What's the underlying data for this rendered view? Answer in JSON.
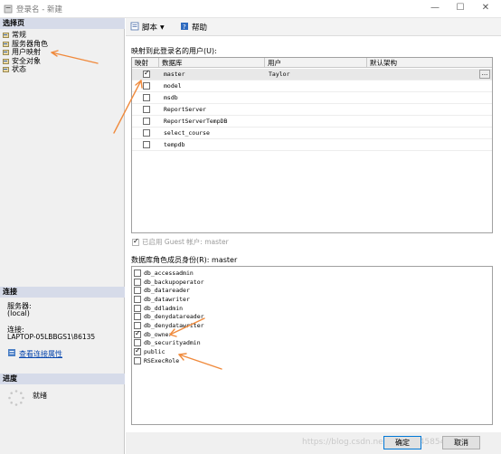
{
  "window": {
    "title": "登录名 - 新建"
  },
  "left": {
    "select_page_header": "选择页",
    "nav_items": [
      "常规",
      "服务器角色",
      "用户映射",
      "安全对象",
      "状态"
    ],
    "connection_header": "连接",
    "server_label": "服务器:",
    "server_value": "(local)",
    "connection_label": "连接:",
    "connection_value": "LAPTOP-05LBBGS1\\86135",
    "view_connection_properties": "查看连接属性",
    "progress_header": "进度",
    "progress_status": "就绪"
  },
  "toolbar": {
    "script_label": "脚本",
    "help_label": "帮助"
  },
  "mapping": {
    "section_label": "映射到此登录名的用户(U):",
    "columns": [
      "映射",
      "数据库",
      "用户",
      "默认架构"
    ],
    "rows": [
      {
        "db": "master",
        "user": "Taylor",
        "schema": "",
        "mapped": true
      },
      {
        "db": "model",
        "user": "",
        "schema": "",
        "mapped": false
      },
      {
        "db": "msdb",
        "user": "",
        "schema": "",
        "mapped": false
      },
      {
        "db": "ReportServer",
        "user": "",
        "schema": "",
        "mapped": false
      },
      {
        "db": "ReportServerTempDB",
        "user": "",
        "schema": "",
        "mapped": false
      },
      {
        "db": "select_course",
        "user": "",
        "schema": "",
        "mapped": false
      },
      {
        "db": "tempdb",
        "user": "",
        "schema": "",
        "mapped": false
      }
    ],
    "ellipsis": "..."
  },
  "guest": {
    "label": "已启用 Guest 帐户: master"
  },
  "roles": {
    "section_label": "数据库角色成员身份(R): master",
    "items": [
      {
        "name": "db_accessadmin",
        "checked": false
      },
      {
        "name": "db_backupoperator",
        "checked": false
      },
      {
        "name": "db_datareader",
        "checked": false
      },
      {
        "name": "db_datawriter",
        "checked": false
      },
      {
        "name": "db_ddladmin",
        "checked": false
      },
      {
        "name": "db_denydatareader",
        "checked": false
      },
      {
        "name": "db_denydatawriter",
        "checked": false
      },
      {
        "name": "db_owner",
        "checked": true
      },
      {
        "name": "db_securityadmin",
        "checked": false
      },
      {
        "name": "public",
        "checked": true
      },
      {
        "name": "RSExecRole",
        "checked": false
      }
    ]
  },
  "footer": {
    "ok_label": "确定",
    "cancel_label": "取消",
    "watermark": "https://blog.csdn.net/weixin_45854851"
  },
  "colors": {
    "accent": "#0078d7",
    "annotation_arrow": "#f08a3c",
    "pane_header": "#d6dbe9"
  }
}
